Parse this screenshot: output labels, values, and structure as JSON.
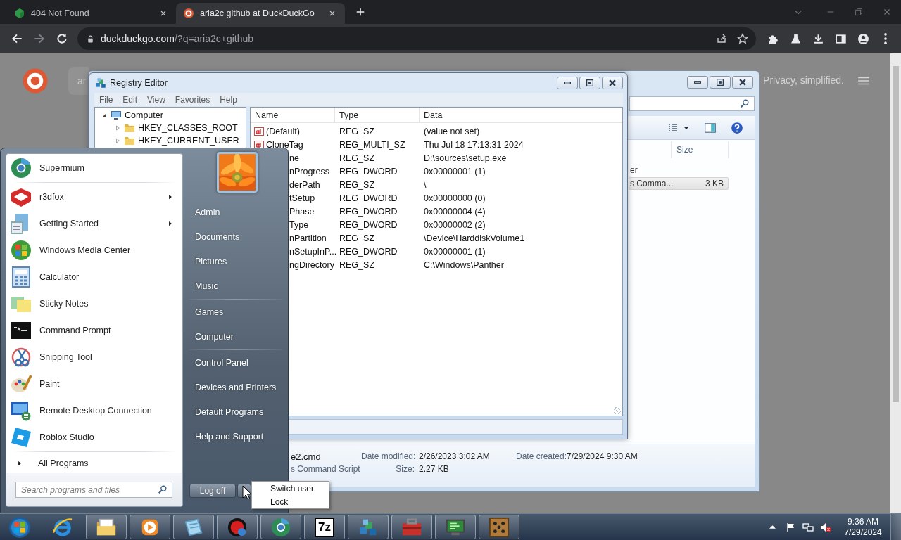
{
  "browser": {
    "tabs": [
      {
        "title": "404 Not Found",
        "selected": false
      },
      {
        "title": "aria2c github at DuckDuckGo",
        "selected": true
      }
    ],
    "address": {
      "host": "duckduckgo.com",
      "path": "/?q=aria2c+github"
    },
    "page": {
      "search_value": "ar",
      "tagline": "Privacy, simplified."
    }
  },
  "explorer": {
    "columns": [
      "Size"
    ],
    "rows": [
      {
        "type": "er",
        "selected": false
      },
      {
        "type": "s Comma...",
        "size": "3 KB",
        "selected": true
      }
    ],
    "details": {
      "name": "e2.cmd",
      "kind": "s Command Script",
      "fields": [
        {
          "label": "Date modified:",
          "value": "2/26/2023 3:02 AM"
        },
        {
          "label": "Date created:",
          "value": "7/29/2024 9:30 AM"
        },
        {
          "label": "Size:",
          "value": "2.27 KB"
        }
      ]
    }
  },
  "registry": {
    "title": "Registry Editor",
    "menu": [
      "File",
      "Edit",
      "View",
      "Favorites",
      "Help"
    ],
    "tree": {
      "label": "Computer",
      "expanded": true,
      "children": [
        {
          "label": "HKEY_CLASSES_ROOT",
          "expanded": false
        },
        {
          "label": "HKEY_CURRENT_USER",
          "expanded": false
        }
      ]
    },
    "columns": [
      "Name",
      "Type",
      "Data"
    ],
    "values": [
      {
        "name": "(Default)",
        "type": "REG_SZ",
        "data": "(value not set)",
        "covered": false
      },
      {
        "name": "CloneTag",
        "type": "REG_MULTI_SZ",
        "data": "Thu Jul 18 17:13:31 2024",
        "covered": false
      },
      {
        "name": "ne",
        "type": "REG_SZ",
        "data": "D:\\sources\\setup.exe",
        "covered": true
      },
      {
        "name": "nProgress",
        "type": "REG_DWORD",
        "data": "0x00000001 (1)",
        "covered": true
      },
      {
        "name": "derPath",
        "type": "REG_SZ",
        "data": "\\",
        "covered": true
      },
      {
        "name": "tSetup",
        "type": "REG_DWORD",
        "data": "0x00000000 (0)",
        "covered": true
      },
      {
        "name": "Phase",
        "type": "REG_DWORD",
        "data": "0x00000004 (4)",
        "covered": true
      },
      {
        "name": "Type",
        "type": "REG_DWORD",
        "data": "0x00000002 (2)",
        "covered": true
      },
      {
        "name": "nPartition",
        "type": "REG_SZ",
        "data": "\\Device\\HarddiskVolume1",
        "covered": true
      },
      {
        "name": "nSetupInP...",
        "type": "REG_DWORD",
        "data": "0x00000001 (1)",
        "covered": true
      },
      {
        "name": "ngDirectory",
        "type": "REG_SZ",
        "data": "C:\\Windows\\Panther",
        "covered": true
      }
    ]
  },
  "start_menu": {
    "pinned": [
      {
        "label": "Supermium",
        "submenu": false
      }
    ],
    "recent": [
      {
        "label": "r3dfox",
        "submenu": true
      },
      {
        "label": "Getting Started",
        "submenu": true
      },
      {
        "label": "Windows Media Center",
        "submenu": false
      },
      {
        "label": "Calculator",
        "submenu": false
      },
      {
        "label": "Sticky Notes",
        "submenu": false
      },
      {
        "label": "Command Prompt",
        "submenu": false
      },
      {
        "label": "Snipping Tool",
        "submenu": false
      },
      {
        "label": "Paint",
        "submenu": false
      },
      {
        "label": "Remote Desktop Connection",
        "submenu": false
      },
      {
        "label": "Roblox Studio",
        "submenu": false
      }
    ],
    "all_programs": "All Programs",
    "search_placeholder": "Search programs and files",
    "places": [
      [
        "Admin",
        "Documents",
        "Pictures",
        "Music"
      ],
      [
        "Games",
        "Computer"
      ],
      [
        "Control Panel",
        "Devices and Printers",
        "Default Programs",
        "Help and Support"
      ]
    ],
    "power_button": "Log off",
    "power_menu": [
      "Switch user",
      "Lock"
    ]
  },
  "taskbar": {
    "items": [
      {
        "running": false
      },
      {
        "running": true
      },
      {
        "running": true
      },
      {
        "running": true
      },
      {
        "running": true
      },
      {
        "running": true
      },
      {
        "running": true,
        "label": "7z"
      },
      {
        "running": true
      },
      {
        "running": true
      },
      {
        "running": true
      },
      {
        "running": true
      }
    ],
    "clock": {
      "time": "9:36 AM",
      "date": "7/29/2024"
    }
  }
}
